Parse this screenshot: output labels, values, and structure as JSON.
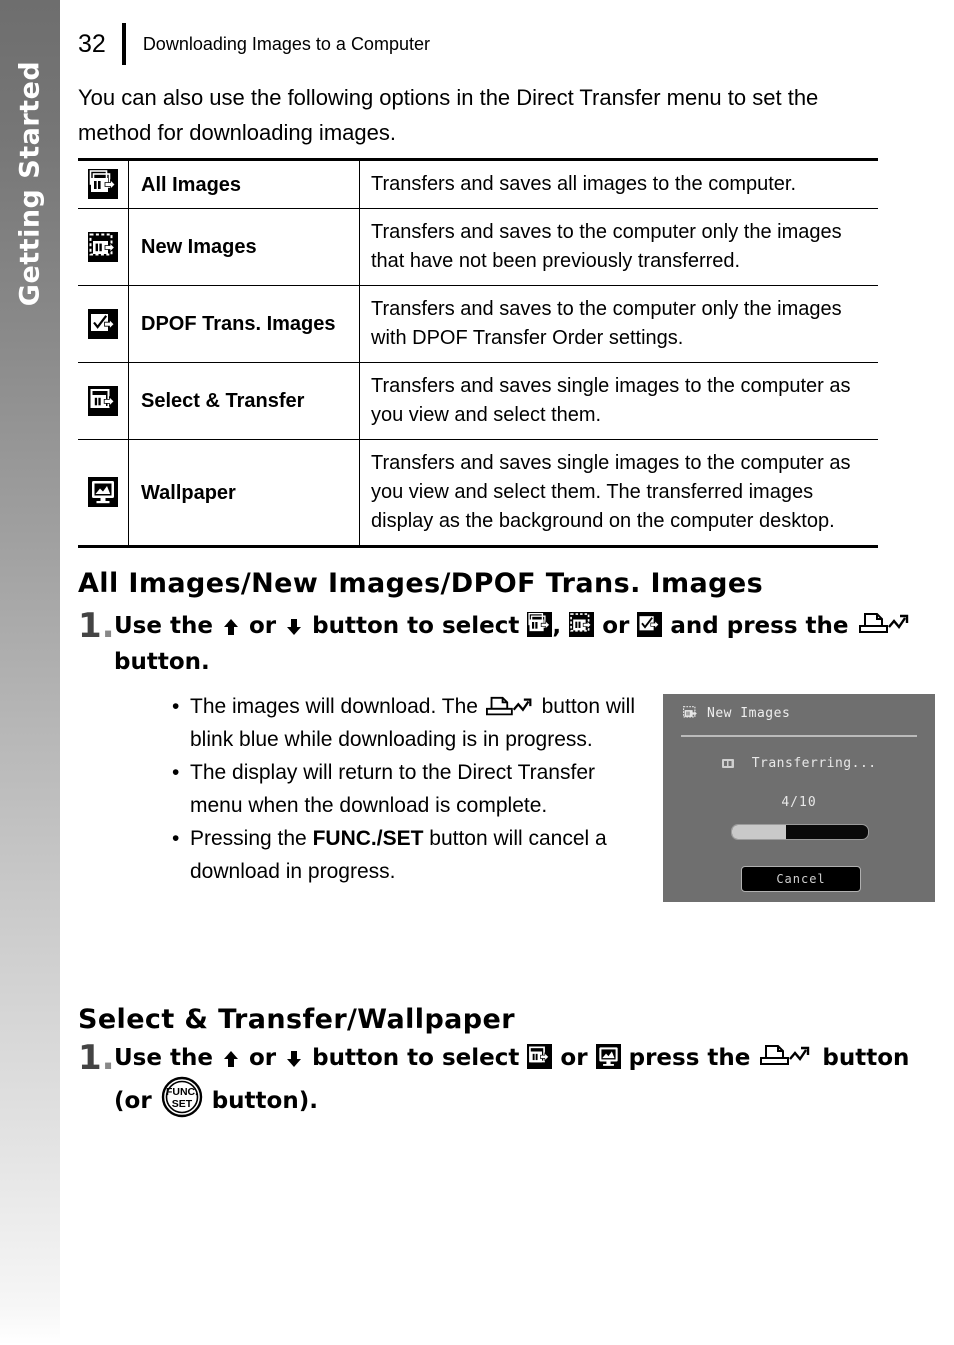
{
  "side_tab": {
    "label": "Getting Started"
  },
  "header": {
    "page_number": "32",
    "title": "Downloading Images to a Computer"
  },
  "intro": {
    "text": "You can also use the following options in the Direct Transfer menu to set the method for downloading images."
  },
  "options_table": {
    "rows": [
      {
        "icon": "all-images-icon",
        "name": "All Images",
        "description": "Transfers and saves all images to the computer."
      },
      {
        "icon": "new-images-icon",
        "name": "New Images",
        "description": "Transfers and saves to the computer only the images that have not been previously transferred."
      },
      {
        "icon": "dpof-trans-images-icon",
        "name": "DPOF Trans. Images",
        "description": "Transfers and saves to the computer only the images with DPOF Transfer Order settings."
      },
      {
        "icon": "select-transfer-icon",
        "name": "Select & Transfer",
        "description": "Transfers and saves single images to the computer as you view and select them."
      },
      {
        "icon": "wallpaper-icon",
        "name": "Wallpaper",
        "description": "Transfers and saves single images to the computer as you view and select them. The transferred images display as the background on the computer desktop."
      }
    ]
  },
  "sections": [
    {
      "heading": "All Images/New Images/DPOF Trans. Images",
      "step_number": "1",
      "step_parts": {
        "p1": "Use the",
        "p2": "or",
        "p3": "button to select",
        "p4": ",",
        "p5": "or",
        "p6": "and press the",
        "p7": "button."
      }
    },
    {
      "heading": "Select & Transfer/Wallpaper",
      "step_number": "1",
      "step_parts": {
        "p1": "Use the",
        "p2": "or",
        "p3": "button to select",
        "p4": "or",
        "p5": "press the",
        "p6": "button (or",
        "p7": "button)."
      }
    }
  ],
  "bullets": [
    {
      "mark": "•",
      "text_before": "The images will download. The",
      "text_after": "button will blink blue while downloading is in progress."
    },
    {
      "mark": "•",
      "text_before": "The display will return to the Direct Transfer menu when the download is complete.",
      "text_after": ""
    },
    {
      "mark": "•",
      "text_before": "Pressing the",
      "bold": "FUNC./SET",
      "text_after": "button will cancel a download in progress."
    }
  ],
  "lcd_screen": {
    "title": "New Images",
    "status": "Transferring...",
    "count": "4/10",
    "progress_percent": 40,
    "cancel_label": "Cancel",
    "background_color": "#6f6f6f",
    "text_color": "#e8e8e8"
  },
  "func_set_button": {
    "line1": "FUNC.",
    "line2": "SET"
  }
}
